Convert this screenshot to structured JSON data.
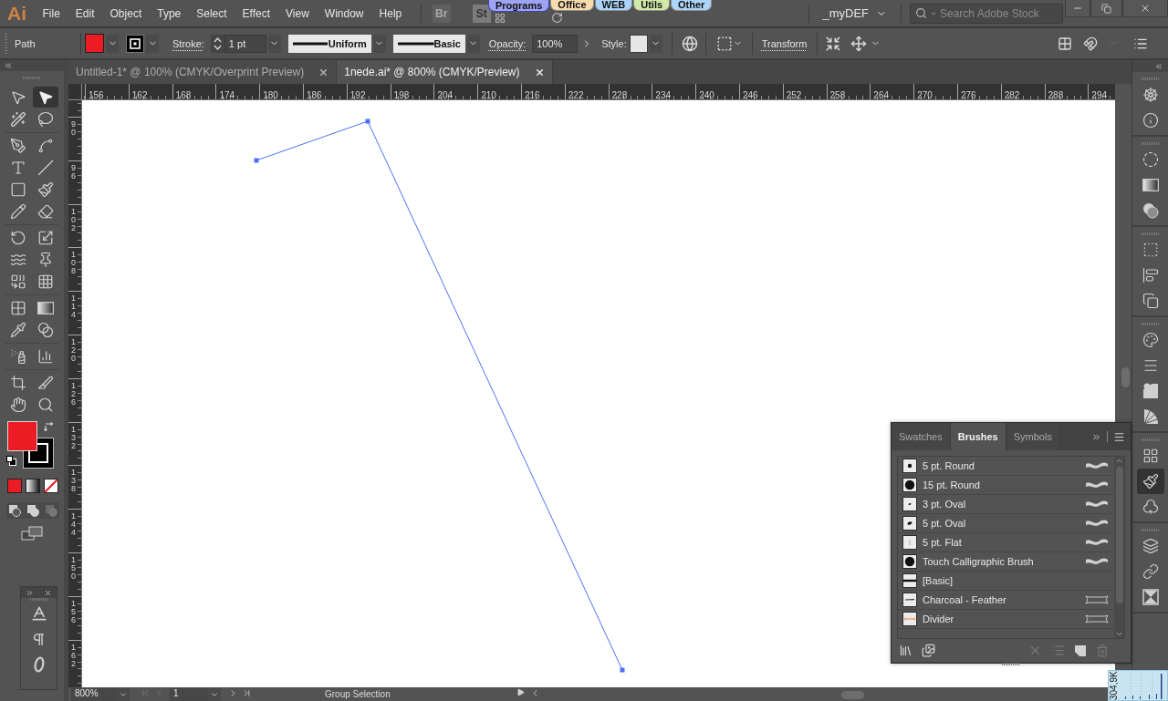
{
  "app": {
    "logo": "Ai"
  },
  "menu": [
    "File",
    "Edit",
    "Object",
    "Type",
    "Select",
    "Effect",
    "View",
    "Window",
    "Help"
  ],
  "bridge_buttons": [
    {
      "label": "Br",
      "dimmed": true
    },
    {
      "label": "St",
      "dimmed": false
    }
  ],
  "workspace_tabs": [
    {
      "label": "Programs",
      "color": "#9ea3f2",
      "selected": true
    },
    {
      "label": "Office",
      "color": "#f8dcae",
      "selected": false
    },
    {
      "label": "WEB",
      "color": "#acd3f8",
      "selected": false
    },
    {
      "label": "Utils",
      "color": "#d2eaa8",
      "selected": false
    },
    {
      "label": "Other",
      "color": "#acd3f8",
      "selected": false
    }
  ],
  "workspace": {
    "name": "_myDEF"
  },
  "search": {
    "placeholder": "Search Adobe Stock"
  },
  "control_bar": {
    "selection": "Path",
    "stroke_label": "Stroke:",
    "stroke_weight": "1 pt",
    "width_profile": "Uniform",
    "brush": "Basic",
    "opacity_label": "Opacity:",
    "opacity": "100%",
    "style_label": "Style:",
    "transform": "Transform"
  },
  "document_tabs": [
    {
      "title": "Untitled-1* @ 100% (CMYK/Overprint Preview)",
      "selected": false
    },
    {
      "title": "1nede.ai* @ 800% (CMYK/Preview)",
      "selected": true
    }
  ],
  "rulers": {
    "horizontal": [
      "156",
      "162",
      "168",
      "174",
      "180",
      "186",
      "192",
      "198",
      "204",
      "210",
      "216",
      "222",
      "228",
      "234",
      "240",
      "246",
      "252",
      "258",
      "264",
      "270",
      "276",
      "282",
      "288",
      "294"
    ],
    "vertical": [
      "90",
      "96",
      "102",
      "108",
      "114",
      "120",
      "126",
      "132",
      "138",
      "144",
      "150",
      "156",
      "162"
    ]
  },
  "tools": [
    [
      {
        "kind": "selection",
        "selected": false
      },
      {
        "kind": "direct-selection",
        "selected": true
      },
      {
        "kind": "magic-wand",
        "selected": false
      },
      {
        "kind": "lasso",
        "selected": false
      }
    ],
    [
      {
        "kind": "pen",
        "selected": false
      },
      {
        "kind": "curvature",
        "selected": false
      },
      {
        "kind": "type",
        "selected": false
      },
      {
        "kind": "line",
        "selected": false
      },
      {
        "kind": "rectangle",
        "selected": false
      },
      {
        "kind": "paintbrush",
        "selected": false
      },
      {
        "kind": "shaper",
        "selected": false
      },
      {
        "kind": "eraser",
        "selected": false
      }
    ],
    [
      {
        "kind": "rotate",
        "selected": false
      },
      {
        "kind": "scale",
        "selected": false
      },
      {
        "kind": "width",
        "selected": false
      },
      {
        "kind": "puppet-warp",
        "selected": false
      },
      {
        "kind": "shape-builder",
        "selected": false
      },
      {
        "kind": "perspective-grid",
        "selected": false
      }
    ],
    [
      {
        "kind": "mesh",
        "selected": false
      },
      {
        "kind": "gradient",
        "selected": false
      },
      {
        "kind": "eyedropper",
        "selected": false
      },
      {
        "kind": "blend",
        "selected": false
      }
    ],
    [
      {
        "kind": "symbol-sprayer",
        "selected": false
      },
      {
        "kind": "graph",
        "selected": false
      }
    ],
    [
      {
        "kind": "artboard",
        "selected": false
      },
      {
        "kind": "slice",
        "selected": false
      },
      {
        "kind": "hand",
        "selected": false
      },
      {
        "kind": "zoom",
        "selected": false
      }
    ]
  ],
  "dock": [
    [
      {
        "kind": "ship-wheel",
        "selected": false
      },
      {
        "kind": "info",
        "selected": false
      }
    ],
    [
      {
        "kind": "appearance",
        "selected": false
      },
      {
        "kind": "gradient",
        "selected": false
      },
      {
        "kind": "transparency",
        "selected": false
      }
    ],
    [
      {
        "kind": "transform",
        "selected": false
      },
      {
        "kind": "align",
        "selected": false
      },
      {
        "kind": "pathfinder",
        "selected": false
      }
    ],
    [
      {
        "kind": "color",
        "selected": false
      },
      {
        "kind": "stroke",
        "selected": false
      },
      {
        "kind": "graphic-styles",
        "selected": false
      },
      {
        "kind": "color-guide",
        "selected": false
      }
    ],
    [
      {
        "kind": "swatches",
        "selected": false
      },
      {
        "kind": "brushes",
        "selected": true
      },
      {
        "kind": "symbols",
        "selected": false
      }
    ],
    [
      {
        "kind": "layers",
        "selected": false
      },
      {
        "kind": "links",
        "selected": false
      },
      {
        "kind": "artboards",
        "selected": false
      }
    ]
  ],
  "brushes_panel": {
    "tabs": [
      {
        "label": "Swatches",
        "selected": false
      },
      {
        "label": "Brushes",
        "selected": true
      },
      {
        "label": "Symbols",
        "selected": false
      }
    ],
    "brushes": [
      {
        "name": "5 pt. Round",
        "thumbnail": {
          "kind": "round-small"
        },
        "kind": "calligraphic"
      },
      {
        "name": "15 pt. Round",
        "thumbnail": {
          "kind": "round-large"
        },
        "kind": "calligraphic"
      },
      {
        "name": "3 pt. Oval",
        "thumbnail": {
          "kind": "oval-small"
        },
        "kind": "calligraphic"
      },
      {
        "name": "5 pt. Oval",
        "thumbnail": {
          "kind": "oval"
        },
        "kind": "calligraphic"
      },
      {
        "name": "5 pt. Flat",
        "thumbnail": {
          "kind": "flat"
        },
        "kind": "calligraphic"
      },
      {
        "name": "Touch Calligraphic Brush",
        "thumbnail": {
          "kind": "round-large"
        },
        "kind": "calligraphic"
      },
      {
        "name": "[Basic]",
        "thumbnail": {
          "kind": "basic"
        },
        "kind": "basic"
      },
      {
        "name": "Charcoal - Feather",
        "thumbnail": {
          "kind": "charcoal"
        },
        "kind": "art"
      },
      {
        "name": "Divider",
        "thumbnail": {
          "kind": "divider"
        },
        "kind": "art"
      }
    ]
  },
  "status_bar": {
    "zoom": "800%",
    "artboard": "1",
    "tool": "Group Selection"
  },
  "performance": {
    "reading": "304,9K"
  }
}
